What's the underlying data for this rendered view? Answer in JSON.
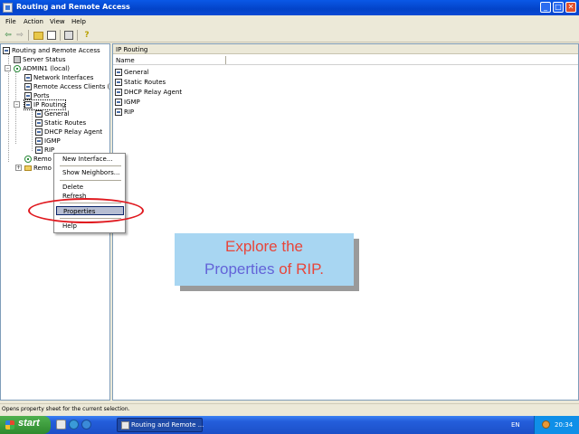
{
  "window": {
    "title": "Routing and Remote Access",
    "controls": {
      "minimize": "_",
      "maximize": "□",
      "close": "✕"
    }
  },
  "menu": {
    "file": "File",
    "action": "Action",
    "view": "View",
    "help": "Help"
  },
  "toolbar": {
    "back_icon": "arrow-left",
    "forward_icon": "arrow-right",
    "up_icon": "folder-up",
    "show_hide_tree_icon": "console-tree",
    "properties_icon": "properties",
    "export_icon": "export-list",
    "help_icon": "help"
  },
  "tree": {
    "root": "Routing and Remote Access",
    "items": [
      {
        "label": "Server Status"
      },
      {
        "label": "ADMIN1 (local)"
      },
      {
        "label": "Network Interfaces"
      },
      {
        "label": "Remote Access Clients (0)"
      },
      {
        "label": "Ports"
      },
      {
        "label": "IP Routing"
      },
      {
        "label": "General"
      },
      {
        "label": "Static Routes"
      },
      {
        "label": "DHCP Relay Agent"
      },
      {
        "label": "IGMP"
      },
      {
        "label": "RIP"
      },
      {
        "label": "Remo"
      },
      {
        "label": "Remo"
      }
    ]
  },
  "right_pane": {
    "header": "IP Routing",
    "column_name": "Name",
    "items": [
      "General",
      "Static Routes",
      "DHCP Relay Agent",
      "IGMP",
      "RIP"
    ]
  },
  "context_menu": {
    "new_interface": "New Interface...",
    "show_neighbors": "Show Neighbors...",
    "delete": "Delete",
    "refresh": "Refresh",
    "properties": "Properties",
    "help": "Help"
  },
  "callout": {
    "line1": "Explore the",
    "line2_highlight": "Properties",
    "line2_rest": " of RIP."
  },
  "status": {
    "text": "Opens property sheet for the current selection."
  },
  "taskbar": {
    "start": "start",
    "task_button": "Routing and Remote ...",
    "language": "EN",
    "clock": "20:34"
  },
  "colors": {
    "titlebar": "#0343c8",
    "accent_red": "#e0191f",
    "callout_bg": "#a8d6f2",
    "callout_text": "#e8453a",
    "callout_highlight": "#6363d8"
  }
}
